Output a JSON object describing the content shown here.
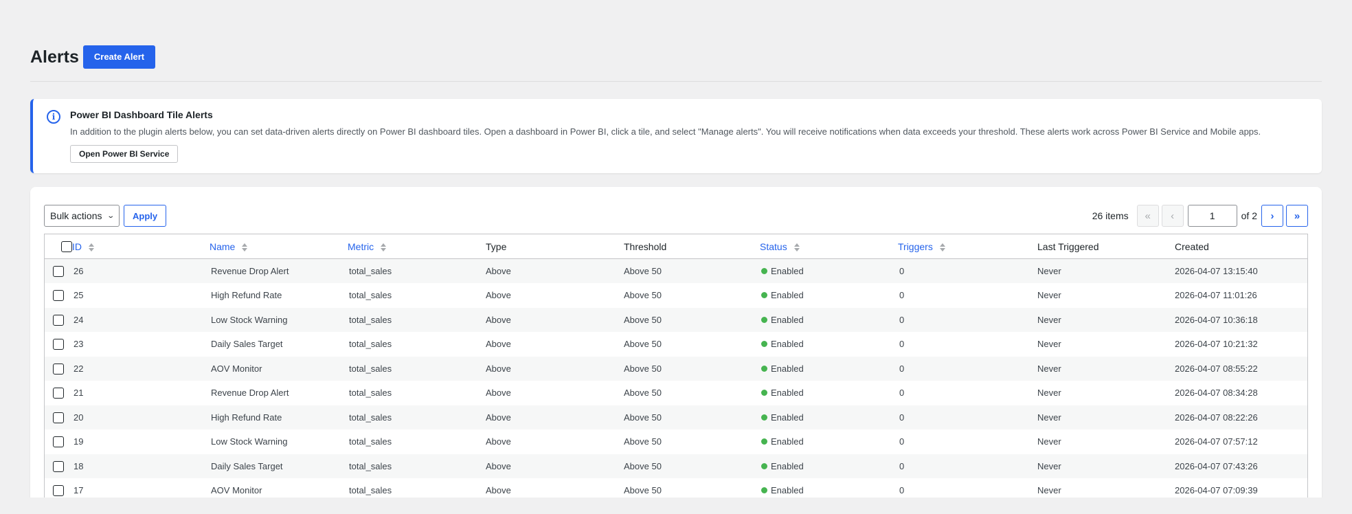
{
  "page": {
    "title": "Alerts",
    "create_button": "Create Alert"
  },
  "notice": {
    "icon": "info-icon",
    "title": "Power BI Dashboard Tile Alerts",
    "text": "In addition to the plugin alerts below, you can set data-driven alerts directly on Power BI dashboard tiles. Open a dashboard in Power BI, click a tile, and select \"Manage alerts\". You will receive notifications when data exceeds your threshold. These alerts work across Power BI Service and Mobile apps.",
    "button": "Open Power BI Service",
    "accent_color": "#2563eb"
  },
  "toolbar": {
    "bulk_actions": "Bulk actions",
    "apply": "Apply"
  },
  "pagination": {
    "items_count": "26 items",
    "first": "«",
    "prev": "‹",
    "current_page": "1",
    "of_total": "of 2",
    "next": "›",
    "last": "»"
  },
  "table": {
    "columns": {
      "id": "ID",
      "name": "Name",
      "metric": "Metric",
      "type": "Type",
      "threshold": "Threshold",
      "status": "Status",
      "triggers": "Triggers",
      "last_triggered": "Last Triggered",
      "created": "Created"
    },
    "rows": [
      {
        "id": "26",
        "name": "Revenue Drop Alert",
        "metric": "total_sales",
        "type": "Above",
        "threshold": "Above 50",
        "status": "Enabled",
        "triggers": "0",
        "last_triggered": "Never",
        "created": "2026-04-07 13:15:40"
      },
      {
        "id": "25",
        "name": "High Refund Rate",
        "metric": "total_sales",
        "type": "Above",
        "threshold": "Above 50",
        "status": "Enabled",
        "triggers": "0",
        "last_triggered": "Never",
        "created": "2026-04-07 11:01:26"
      },
      {
        "id": "24",
        "name": "Low Stock Warning",
        "metric": "total_sales",
        "type": "Above",
        "threshold": "Above 50",
        "status": "Enabled",
        "triggers": "0",
        "last_triggered": "Never",
        "created": "2026-04-07 10:36:18"
      },
      {
        "id": "23",
        "name": "Daily Sales Target",
        "metric": "total_sales",
        "type": "Above",
        "threshold": "Above 50",
        "status": "Enabled",
        "triggers": "0",
        "last_triggered": "Never",
        "created": "2026-04-07 10:21:32"
      },
      {
        "id": "22",
        "name": "AOV Monitor",
        "metric": "total_sales",
        "type": "Above",
        "threshold": "Above 50",
        "status": "Enabled",
        "triggers": "0",
        "last_triggered": "Never",
        "created": "2026-04-07 08:55:22"
      },
      {
        "id": "21",
        "name": "Revenue Drop Alert",
        "metric": "total_sales",
        "type": "Above",
        "threshold": "Above 50",
        "status": "Enabled",
        "triggers": "0",
        "last_triggered": "Never",
        "created": "2026-04-07 08:34:28"
      },
      {
        "id": "20",
        "name": "High Refund Rate",
        "metric": "total_sales",
        "type": "Above",
        "threshold": "Above 50",
        "status": "Enabled",
        "triggers": "0",
        "last_triggered": "Never",
        "created": "2026-04-07 08:22:26"
      },
      {
        "id": "19",
        "name": "Low Stock Warning",
        "metric": "total_sales",
        "type": "Above",
        "threshold": "Above 50",
        "status": "Enabled",
        "triggers": "0",
        "last_triggered": "Never",
        "created": "2026-04-07 07:57:12"
      },
      {
        "id": "18",
        "name": "Daily Sales Target",
        "metric": "total_sales",
        "type": "Above",
        "threshold": "Above 50",
        "status": "Enabled",
        "triggers": "0",
        "last_triggered": "Never",
        "created": "2026-04-07 07:43:26"
      },
      {
        "id": "17",
        "name": "AOV Monitor",
        "metric": "total_sales",
        "type": "Above",
        "threshold": "Above 50",
        "status": "Enabled",
        "triggers": "0",
        "last_triggered": "Never",
        "created": "2026-04-07 07:09:39"
      }
    ]
  },
  "colors": {
    "primary": "#2563eb",
    "status_enabled": "#46b450"
  }
}
